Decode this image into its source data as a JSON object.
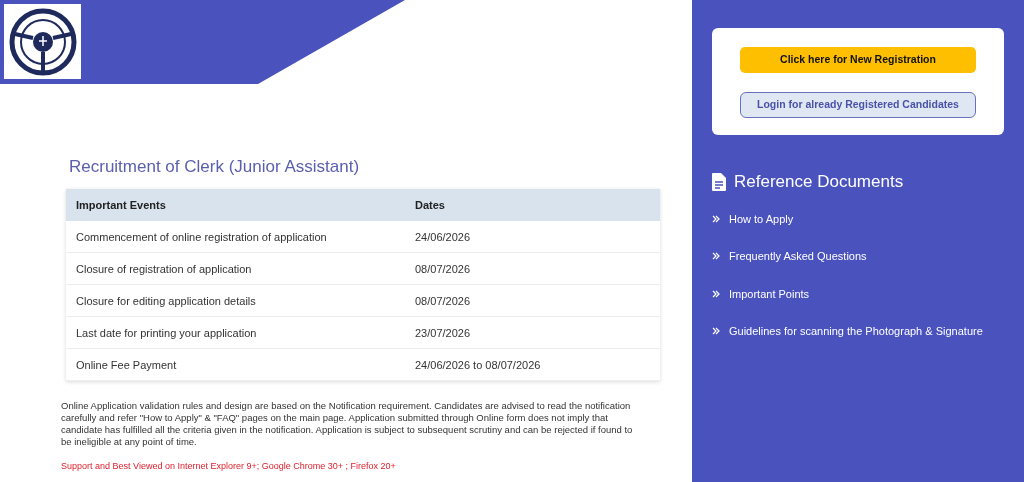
{
  "main": {
    "title": "Recruitment of Clerk (Junior Assistant)",
    "table": {
      "columns": [
        "Important Events",
        "Dates"
      ],
      "rows": [
        [
          "Commencement of online registration of application",
          "24/06/2026"
        ],
        [
          "Closure of registration of application",
          "08/07/2026"
        ],
        [
          "Closure for editing application details",
          "08/07/2026"
        ],
        [
          "Last date for printing your application",
          "23/07/2026"
        ],
        [
          "Online Fee Payment",
          "24/06/2026 to 08/07/2026"
        ]
      ]
    },
    "notice": "Online Application validation rules and design are based on the Notification requirement. Candidates are advised to read the notification carefully and refer \"How to Apply\" & \"FAQ\" pages on the main page. Application submitted through Online form does not imply that candidate has fulfilled all the criteria given in the notification. Application is subject to subsequent scrutiny and can be rejected if found to be ineligible at any point of time.",
    "browser_support": "Support and Best Viewed on Internet Explorer 9+; Google Chrome 30+ ; Firefox 20+"
  },
  "sidebar": {
    "buttons": [
      {
        "kind": "primary",
        "label": "Click here for New Registration"
      },
      {
        "kind": "secondary",
        "label": "Login for already Registered Candidates"
      }
    ],
    "heading": "Reference Documents",
    "links": [
      "How to Apply",
      "Frequently Asked Questions",
      "Important Points",
      "Guidelines for scanning the Photograph & Signature"
    ]
  }
}
